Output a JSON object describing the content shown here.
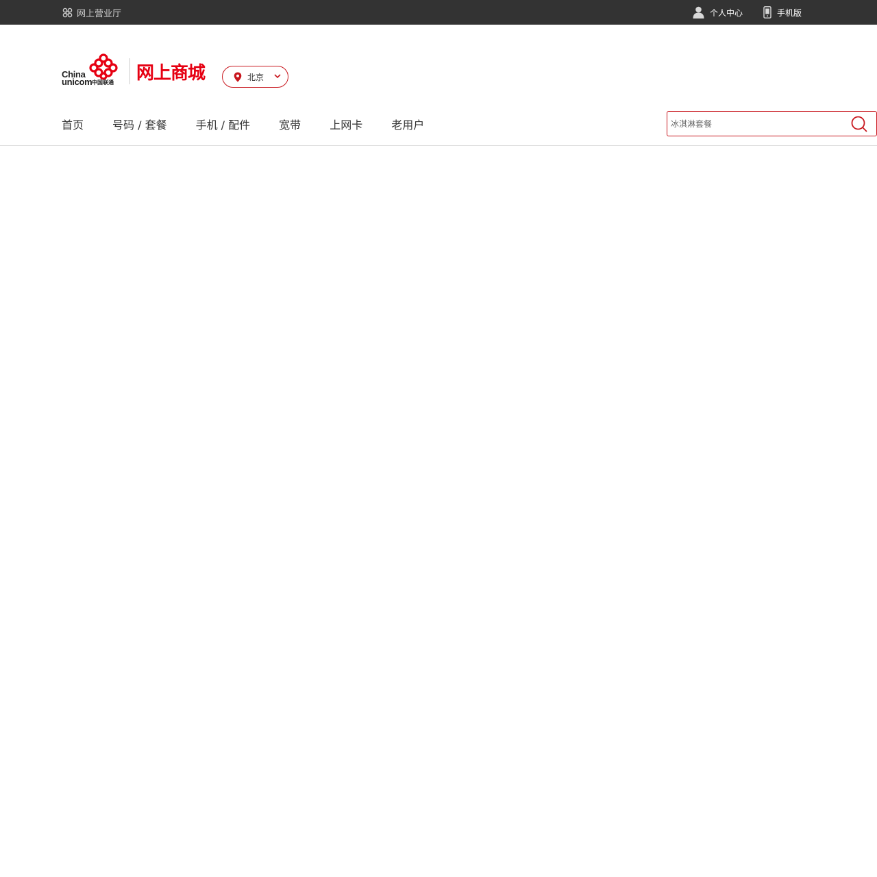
{
  "topbar": {
    "left_label": "网上营业厅",
    "left_icon": "unicom-knot-icon",
    "right_links": [
      {
        "label": "个人中心",
        "icon": "user-icon"
      },
      {
        "label": "手机版",
        "icon": "mobile-phone-icon"
      }
    ]
  },
  "logo": {
    "en_line1": "China",
    "en_line2": "unicom",
    "cn_small": "中国联通",
    "mall_text": "网上商城",
    "brand_color": "#e60012"
  },
  "city_selector": {
    "icon": "location-pin-icon",
    "value": "北京"
  },
  "nav": {
    "items": [
      "首页",
      "号码 / 套餐",
      "手机 / 配件",
      "宽带",
      "上网卡",
      "老用户"
    ]
  },
  "search": {
    "placeholder": "冰淇淋套餐",
    "icon": "search-icon",
    "border_color": "#c8161d"
  },
  "colors": {
    "topbar_bg": "#333333",
    "accent": "#c8161d"
  }
}
